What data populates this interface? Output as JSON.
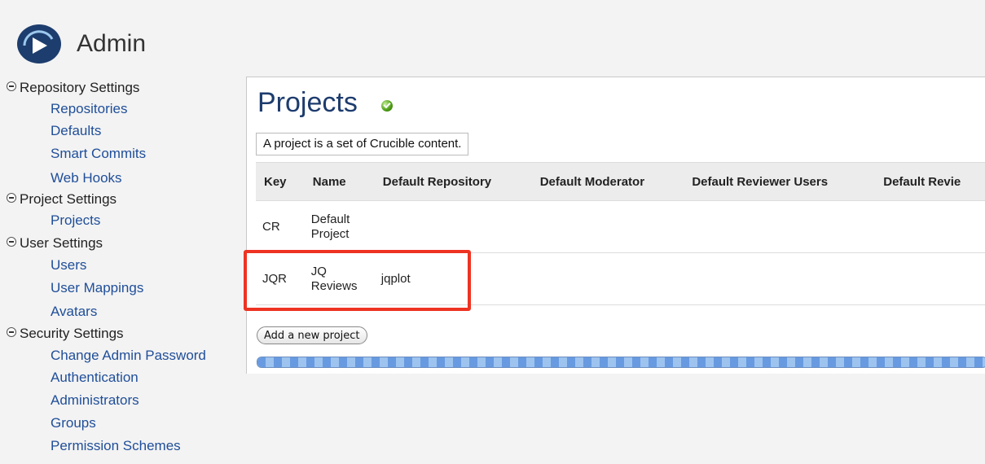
{
  "header": {
    "title": "Admin",
    "logo_icon": "play-circle-logo-icon"
  },
  "sidebar": {
    "sections": [
      {
        "label": "Repository Settings",
        "items": [
          "Repositories",
          "Defaults",
          "Smart Commits",
          "Web Hooks"
        ]
      },
      {
        "label": "Project Settings",
        "items": [
          "Projects"
        ]
      },
      {
        "label": "User Settings",
        "items": [
          "Users",
          "User Mappings",
          "Avatars"
        ]
      },
      {
        "label": "Security Settings",
        "items": [
          "Change Admin Password",
          "Authentication",
          "Administrators",
          "Groups",
          "Permission Schemes"
        ]
      }
    ],
    "link_color": "#1f4e99"
  },
  "main": {
    "title": "Projects",
    "status_icon": "green-check-icon",
    "description": "A project is a set of Crucible content.",
    "table": {
      "headers": [
        "Key",
        "Name",
        "Default Repository",
        "Default Moderator",
        "Default Reviewer Users",
        "Default Revie"
      ],
      "rows": [
        {
          "key": "CR",
          "name_line1": "Default",
          "name_line2": "Project",
          "repo": ""
        },
        {
          "key": "JQR",
          "name_line1": "JQ",
          "name_line2": "Reviews",
          "repo": "jqplot"
        }
      ]
    },
    "add_button": "Add a new project",
    "progress": 1.0,
    "highlight_color": "#ee3322"
  }
}
